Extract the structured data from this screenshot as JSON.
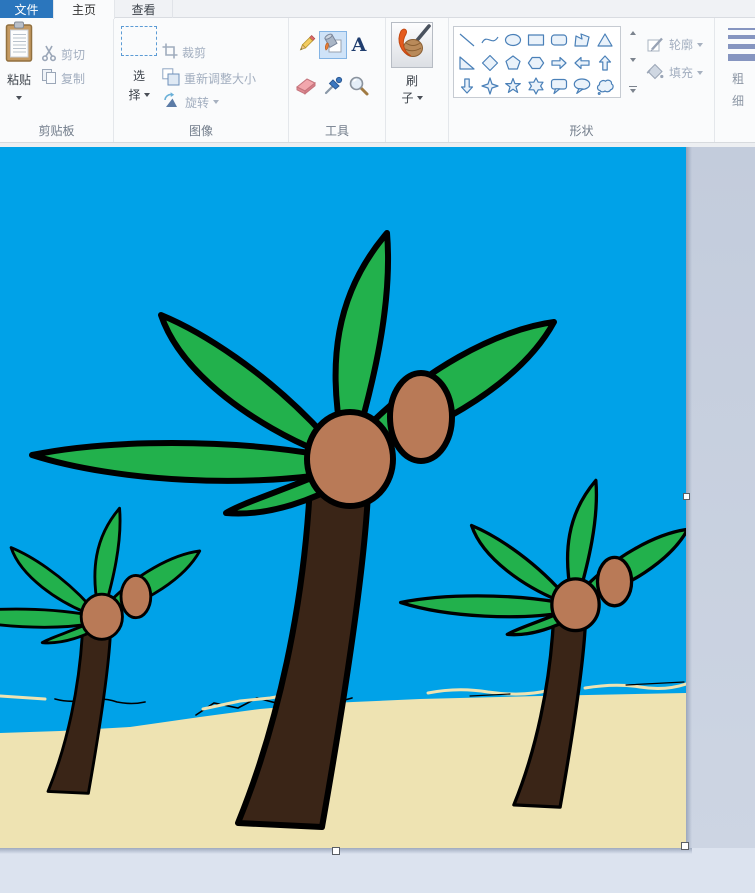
{
  "tabs": {
    "file": "文件",
    "home": "主页",
    "view": "查看"
  },
  "ribbon": {
    "clipboard": {
      "label": "剪贴板",
      "paste": "粘贴",
      "cut": "剪切",
      "copy": "复制"
    },
    "image": {
      "label": "图像",
      "select_l1": "选",
      "select_l2": "择",
      "crop": "裁剪",
      "resize": "重新调整大小",
      "rotate": "旋转"
    },
    "tools": {
      "label": "工具",
      "selected": "fill",
      "items": [
        "pencil",
        "fill",
        "text",
        "eraser",
        "eyedropper",
        "magnifier"
      ]
    },
    "brush": {
      "l1": "刷",
      "l2": "子"
    },
    "shapes": {
      "label": "形状",
      "outline": "轮廓",
      "fill": "填充",
      "items": [
        "line",
        "curve",
        "ellipse",
        "rectangle",
        "rounded-rectangle",
        "polygon",
        "triangle",
        "right-triangle",
        "diamond",
        "pentagon",
        "hexagon",
        "arrow-right",
        "arrow-left",
        "arrow-up",
        "arrow-down",
        "star-4",
        "star-5",
        "star-6",
        "callout-round",
        "callout-oval",
        "callout-cloud"
      ]
    },
    "size": {
      "l1": "粗",
      "l2": "细"
    }
  },
  "ui_colors": {
    "file_tab": "#2b76bd",
    "tool_selected_bg": "#cfe3f8",
    "tool_selected_border": "#84b4e4",
    "shape_stroke": "#4a80b8"
  },
  "canvas": {
    "colors": {
      "sky": "#00a2e8",
      "sand": "#eee3b2",
      "leaf": "#22b14c",
      "trunk": "#3a2517",
      "coconut": "#b97a57",
      "outline": "#000000"
    }
  }
}
